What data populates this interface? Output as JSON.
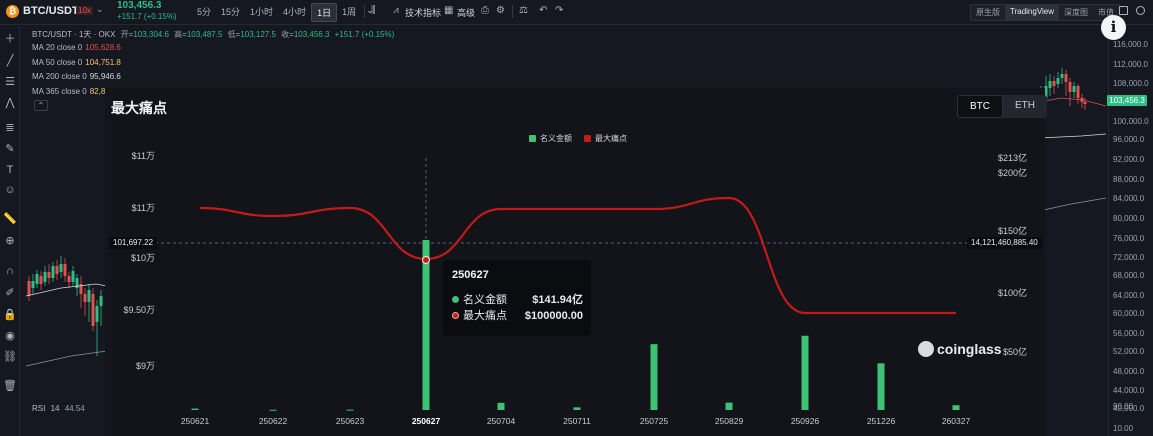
{
  "toolbar": {
    "coin_letter": "₿",
    "symbol": "BTC/USDT",
    "leverage": "10x",
    "price": "103,456.3",
    "change": "+151.7 (+0.15%)",
    "intervals": [
      "5分",
      "15分",
      "1小时",
      "4小时",
      "1日",
      "1周"
    ],
    "active_interval": "1日",
    "indicators_label": "技术指标",
    "advanced_label": "高级",
    "views": [
      "原生版",
      "TradingView",
      "深度图",
      "市值"
    ],
    "active_view": "TradingView"
  },
  "chart_header": {
    "title_line": "BTC/USDT · 1天 · OKX",
    "open_label": "开=",
    "open": "103,304.6",
    "high_label": "高=",
    "high": "103,487.5",
    "low_label": "低=",
    "low": "103,127.5",
    "close_label": "收=",
    "close": "103,456.3",
    "change": "+151.7 (+0.15%)"
  },
  "ma_lines": [
    {
      "label": "MA 20 close 0",
      "value": "105,628.6",
      "color": "#e2514c"
    },
    {
      "label": "MA 50 close 0",
      "value": "104,751.8",
      "color": "#f2c46d"
    },
    {
      "label": "MA 200 close 0",
      "value": "95,946.6",
      "color": "#d6d8dc"
    },
    {
      "label": "MA 365 close 0",
      "value": "82,8",
      "color": "#f2c46d"
    }
  ],
  "price_axis": [
    "116,000.0",
    "112,000.0",
    "108,000.0",
    "100,000.0",
    "96,000.0",
    "92,000.0",
    "88,000.0",
    "84,000.0",
    "80,000.0",
    "76,000.0",
    "72,000.0",
    "68,000.0",
    "64,000.0",
    "60,000.0",
    "56,000.0",
    "52,000.0",
    "48,000.0",
    "44,000.0",
    "40,000.0",
    "90.00",
    "10.00"
  ],
  "current_price_tag": "103,456.3",
  "rsi": {
    "label": "RSI",
    "period": "14",
    "value": "44.54"
  },
  "overlay": {
    "title": "最大痛点",
    "coins": [
      "BTC",
      "ETH"
    ],
    "active_coin": "BTC",
    "crosshair_left": "101,697.22",
    "crosshair_right": "14,121,460,885.40",
    "watermark": "coinglass",
    "tooltip": {
      "date": "250627",
      "rows": [
        {
          "label": "名义金额",
          "value": "$141.94亿",
          "color": "#3ec274"
        },
        {
          "label": "最大痛点",
          "value": "$100000.00",
          "color": "#c61a1a"
        }
      ]
    }
  },
  "chart_data": {
    "type": "bar",
    "title": "最大痛点",
    "categories": [
      "250621",
      "250622",
      "250623",
      "250627",
      "250704",
      "250711",
      "250725",
      "250829",
      "250926",
      "251226",
      "260327"
    ],
    "series": [
      {
        "name": "名义金额",
        "axis": "right",
        "color": "#3ec274",
        "values": [
          1.2,
          0.2,
          0.3,
          142,
          6.0,
          2.2,
          55,
          6.2,
          62,
          39,
          4.0
        ]
      },
      {
        "name": "最大痛点",
        "axis": "left",
        "type": "line",
        "color": "#c61a1a",
        "values": [
          106000,
          105500,
          106000,
          100000,
          106000,
          106000,
          106000,
          106500,
          92000,
          92000,
          92000
        ]
      }
    ],
    "left_axis": {
      "ticks": [
        "$9万",
        "$9.50万",
        "$10万",
        "$11万",
        "$11万"
      ],
      "tick_values": [
        90000,
        95000,
        100000,
        105000,
        110000
      ],
      "ylim": [
        88000,
        110000
      ]
    },
    "right_axis": {
      "ticks": [
        "$50亿",
        "$100亿",
        "$150亿",
        "$200亿",
        "$213亿"
      ],
      "tick_values": [
        50,
        100,
        150,
        200,
        213
      ],
      "ylim": [
        0,
        213
      ]
    },
    "legend": {
      "position": "top",
      "entries": [
        "名义金额",
        "最大痛点"
      ]
    }
  }
}
